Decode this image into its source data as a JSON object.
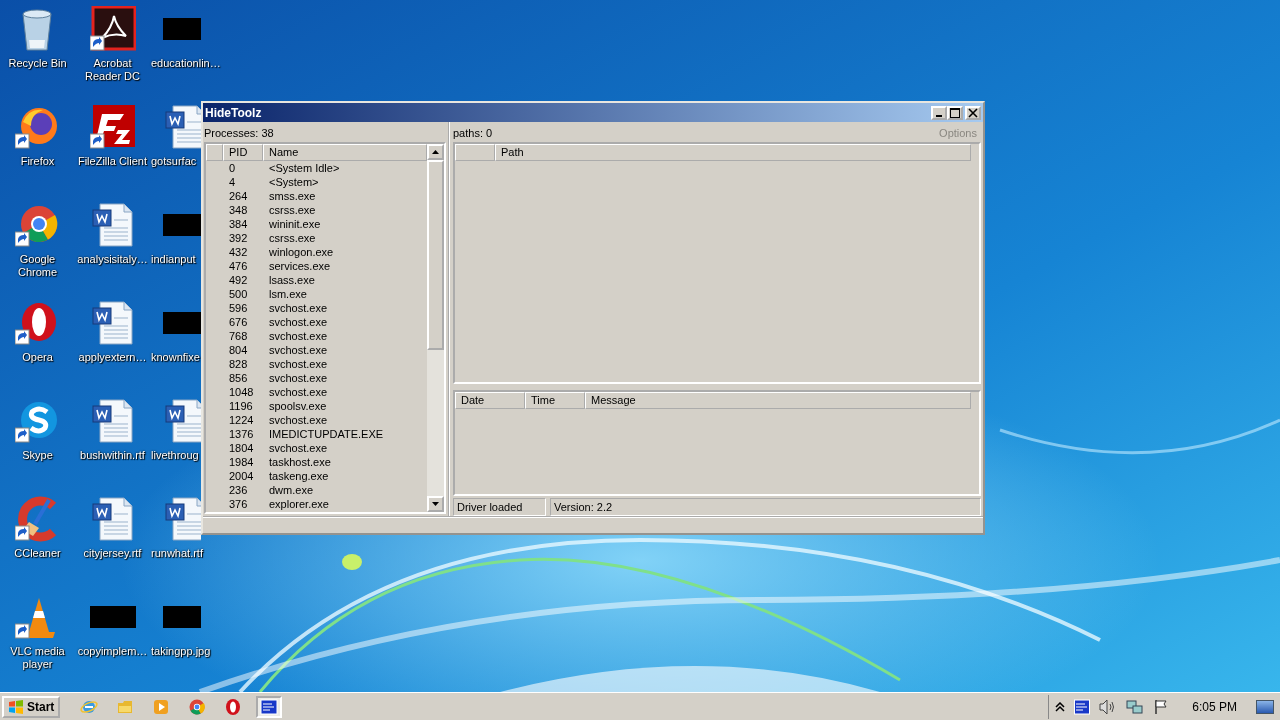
{
  "desktop": {
    "icons": [
      {
        "label": "Recycle Bin",
        "kind": "recycle",
        "shortcut": false
      },
      {
        "label": "Firefox",
        "kind": "firefox",
        "shortcut": true
      },
      {
        "label": "Google Chrome",
        "kind": "chrome",
        "shortcut": true
      },
      {
        "label": "Opera",
        "kind": "opera",
        "shortcut": true
      },
      {
        "label": "Skype",
        "kind": "skype",
        "shortcut": true
      },
      {
        "label": "CCleaner",
        "kind": "ccleaner",
        "shortcut": true
      },
      {
        "label": "VLC media player",
        "kind": "vlc",
        "shortcut": true
      },
      {
        "label": "Acrobat Reader DC",
        "kind": "acrobat",
        "shortcut": true
      },
      {
        "label": "FileZilla Client",
        "kind": "filezilla",
        "shortcut": true
      },
      {
        "label": "analysisitaly…",
        "kind": "word",
        "shortcut": false
      },
      {
        "label": "applyextern…",
        "kind": "word",
        "shortcut": false
      },
      {
        "label": "bushwithin.rtf",
        "kind": "word",
        "shortcut": false
      },
      {
        "label": "cityjersey.rtf",
        "kind": "word",
        "shortcut": false
      },
      {
        "label": "copyimplem…",
        "kind": "redacted",
        "shortcut": false
      },
      {
        "label": "educationlin…",
        "kind": "redacted",
        "shortcut": false
      },
      {
        "label": "gotsurfac",
        "kind": "word",
        "shortcut": false
      },
      {
        "label": "indianput",
        "kind": "redacted",
        "shortcut": false
      },
      {
        "label": "knownfixe",
        "kind": "redacted",
        "shortcut": false
      },
      {
        "label": "livethroug",
        "kind": "word",
        "shortcut": false
      },
      {
        "label": "runwhat.rtf",
        "kind": "word",
        "shortcut": false
      },
      {
        "label": "takingpp.jpg",
        "kind": "redacted",
        "shortcut": false
      }
    ]
  },
  "window": {
    "title": "HideToolz",
    "processes": {
      "label": "Processes: 38",
      "columns": [
        "PID",
        "Name"
      ],
      "rows": [
        {
          "pid": "0",
          "name": "<System Idle>"
        },
        {
          "pid": "4",
          "name": "<System>"
        },
        {
          "pid": "264",
          "name": "smss.exe"
        },
        {
          "pid": "348",
          "name": "csrss.exe"
        },
        {
          "pid": "384",
          "name": "wininit.exe"
        },
        {
          "pid": "392",
          "name": "csrss.exe"
        },
        {
          "pid": "432",
          "name": "winlogon.exe"
        },
        {
          "pid": "476",
          "name": "services.exe"
        },
        {
          "pid": "492",
          "name": "lsass.exe"
        },
        {
          "pid": "500",
          "name": "lsm.exe"
        },
        {
          "pid": "596",
          "name": "svchost.exe"
        },
        {
          "pid": "676",
          "name": "svchost.exe"
        },
        {
          "pid": "768",
          "name": "svchost.exe"
        },
        {
          "pid": "804",
          "name": "svchost.exe"
        },
        {
          "pid": "828",
          "name": "svchost.exe"
        },
        {
          "pid": "856",
          "name": "svchost.exe"
        },
        {
          "pid": "1048",
          "name": "svchost.exe"
        },
        {
          "pid": "1196",
          "name": "spoolsv.exe"
        },
        {
          "pid": "1224",
          "name": "svchost.exe"
        },
        {
          "pid": "1376",
          "name": "IMEDICTUPDATE.EXE"
        },
        {
          "pid": "1804",
          "name": "svchost.exe"
        },
        {
          "pid": "1984",
          "name": "taskhost.exe"
        },
        {
          "pid": "2004",
          "name": "taskeng.exe"
        },
        {
          "pid": "236",
          "name": "dwm.exe"
        },
        {
          "pid": "376",
          "name": "explorer.exe"
        }
      ]
    },
    "paths": {
      "label": "paths: 0",
      "options": {
        "label": "Options",
        "disabled": true
      },
      "columns": [
        "Path"
      ]
    },
    "log": {
      "columns": [
        "Date",
        "Time",
        "Message"
      ]
    },
    "status": [
      "Driver loaded",
      "Version: 2.2"
    ]
  },
  "taskbar": {
    "start": "Start",
    "apps": [
      {
        "kind": "ie",
        "selected": false
      },
      {
        "kind": "folder",
        "selected": false
      },
      {
        "kind": "media",
        "selected": false
      },
      {
        "kind": "chrome",
        "selected": false
      },
      {
        "kind": "opera",
        "selected": false
      },
      {
        "kind": "app",
        "selected": true
      }
    ],
    "clock": "6:05 PM"
  }
}
